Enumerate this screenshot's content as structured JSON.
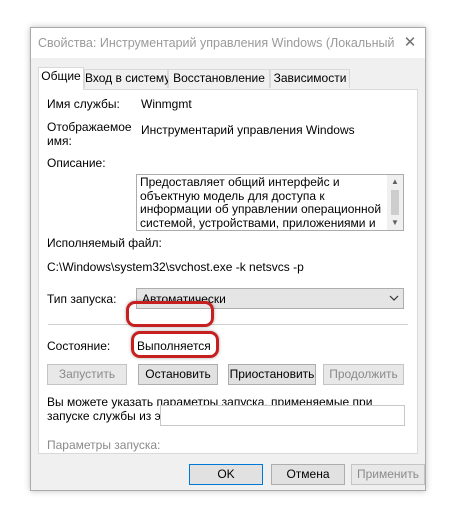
{
  "window": {
    "title": "Свойства: Инструментарий управления Windows (Локальный к...",
    "close_glyph": "✕"
  },
  "tabs": [
    {
      "label": "Общие",
      "active": true
    },
    {
      "label": "Вход в систему",
      "active": false
    },
    {
      "label": "Восстановление",
      "active": false
    },
    {
      "label": "Зависимости",
      "active": false
    }
  ],
  "general": {
    "service_name_label": "Имя службы:",
    "service_name_value": "Winmgmt",
    "display_name_label_line1": "Отображаемое",
    "display_name_label_line2": "имя:",
    "display_name_value": "Инструментарий управления Windows",
    "description_label": "Описание:",
    "description_value": "Предоставляет общий интерфейс и объектную модель для доступа к информации об управлении операционной системой, устройствами, приложениями и службами.",
    "exe_label": "Исполняемый файл:",
    "exe_value": "C:\\Windows\\system32\\svchost.exe -k netsvcs -p",
    "startup_type_label": "Тип запуска:",
    "startup_type_value": "Автоматически",
    "status_label": "Состояние:",
    "status_value": "Выполняется",
    "start_button": "Запустить",
    "stop_button": "Остановить",
    "pause_button": "Приостановить",
    "resume_button": "Продолжить",
    "hint": "Вы можете указать параметры запуска, применяемые при запуске службы из этого диалогового окна.",
    "start_params_label": "Параметры запуска:",
    "start_params_value": ""
  },
  "footer": {
    "ok_button": "OK",
    "cancel_button": "Отмена",
    "apply_button": "Применить"
  },
  "colors": {
    "highlight": "#c51f1f",
    "accent": "#0078d7"
  },
  "icons": {
    "close": "close-icon",
    "scroll_up": "scroll-up-arrow-icon",
    "scroll_down": "scroll-down-arrow-icon",
    "combo": "chevron-down-icon"
  }
}
